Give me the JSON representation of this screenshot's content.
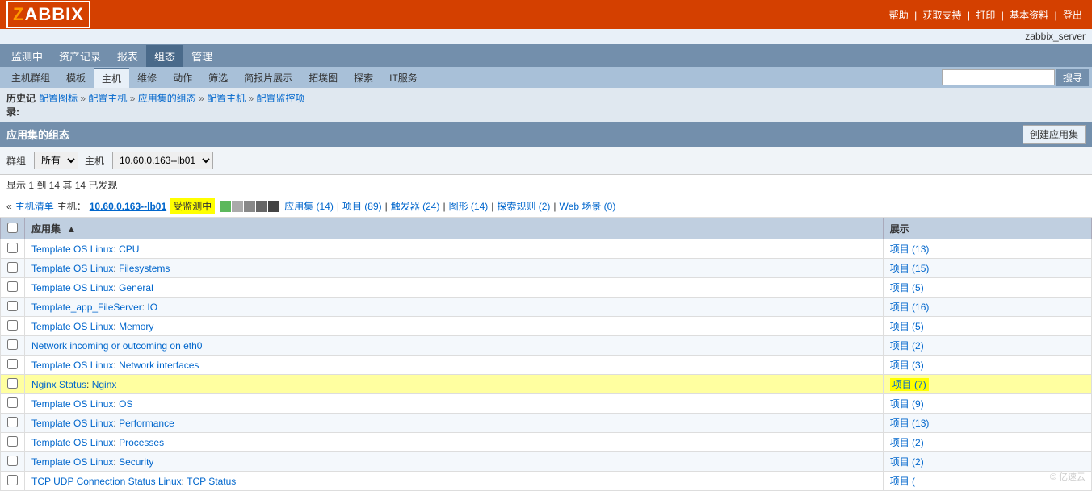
{
  "app": {
    "logo": "ZABBIX",
    "server_name": "zabbix_server"
  },
  "top_links": [
    "帮助",
    "获取支持",
    "打印",
    "基本资料",
    "登出"
  ],
  "main_nav": [
    {
      "label": "监测中",
      "active": false
    },
    {
      "label": "资产记录",
      "active": false
    },
    {
      "label": "报表",
      "active": false
    },
    {
      "label": "组态",
      "active": true
    },
    {
      "label": "管理",
      "active": false
    }
  ],
  "sub_nav": [
    {
      "label": "主机群组",
      "active": false
    },
    {
      "label": "模板",
      "active": false
    },
    {
      "label": "主机",
      "active": true
    },
    {
      "label": "维修",
      "active": false
    },
    {
      "label": "动作",
      "active": false
    },
    {
      "label": "筛选",
      "active": false
    },
    {
      "label": "简报片展示",
      "active": false
    },
    {
      "label": "拓墣图",
      "active": false
    },
    {
      "label": "探索",
      "active": false
    },
    {
      "label": "IT服务",
      "active": false
    }
  ],
  "search": {
    "placeholder": "",
    "button_label": "搜寻"
  },
  "breadcrumb": {
    "history_label": "历史记\n录:",
    "items": [
      {
        "label": "配置图标",
        "href": "#"
      },
      {
        "label": "配置主机",
        "href": "#"
      },
      {
        "label": "应用集的组态",
        "href": "#"
      },
      {
        "label": "配置主机",
        "href": "#"
      },
      {
        "label": "配置监控项",
        "href": "#"
      }
    ]
  },
  "page_title": "应用集的组态",
  "create_button_label": "创建应用集",
  "filter": {
    "group_label": "群组",
    "group_value": "所有",
    "host_label": "主机",
    "host_value": "10.60.0.163--lb01",
    "group_options": [
      "所有"
    ],
    "host_options": [
      "10.60.0.163--lb01"
    ]
  },
  "count_info": "显示 1 到 14 其 14 已发现",
  "context_bar": {
    "prefix": "«",
    "list_label": "主机清单",
    "host_label": "主机：",
    "host_link": "10.60.0.163--lb01",
    "monitoring_label": "受监测中",
    "status_colors": [
      "#5cb85c",
      "#d9534f",
      "#f0ad4e",
      "#777",
      "#999"
    ],
    "links": [
      {
        "label": "应用集 (14)"
      },
      {
        "label": "项目 (89)"
      },
      {
        "label": "触发器 (24)"
      },
      {
        "label": "图形 (14)"
      },
      {
        "label": "探索规则 (2)"
      },
      {
        "label": "Web 场景 (0)"
      }
    ]
  },
  "table": {
    "columns": [
      {
        "label": "",
        "type": "checkbox"
      },
      {
        "label": "应用集",
        "sortable": true
      },
      {
        "label": "展示"
      }
    ],
    "rows": [
      {
        "id": 1,
        "name": "Template OS Linux",
        "name2": "CPU",
        "link1": "Template OS Linux",
        "link2": "CPU",
        "items": "项目 (13)",
        "highlighted": false
      },
      {
        "id": 2,
        "name": "Template OS Linux",
        "name2": "Filesystems",
        "link1": "Template OS Linux",
        "link2": "Filesystems",
        "items": "项目 (15)",
        "highlighted": false
      },
      {
        "id": 3,
        "name": "Template OS Linux",
        "name2": "General",
        "link1": "Template OS Linux",
        "link2": "General",
        "items": "项目 (5)",
        "highlighted": false
      },
      {
        "id": 4,
        "name": "Template_app_FileServer",
        "name2": "IO",
        "link1": "Template_app_FileServer",
        "link2": "IO",
        "items": "项目 (16)",
        "highlighted": false
      },
      {
        "id": 5,
        "name": "Template OS Linux",
        "name2": "Memory",
        "link1": "Template OS Linux",
        "link2": "Memory",
        "items": "项目 (5)",
        "highlighted": false
      },
      {
        "id": 6,
        "name": "Network incoming or outcoming on eth0",
        "name2": "Network incoming or outcoming on eth0",
        "link1": "Network incoming or outcoming on eth0",
        "link2": "",
        "items": "项目 (2)",
        "highlighted": false
      },
      {
        "id": 7,
        "name": "Template OS Linux",
        "name2": "Network interfaces",
        "link1": "Template OS Linux",
        "link2": "Network interfaces",
        "items": "项目 (3)",
        "highlighted": false
      },
      {
        "id": 8,
        "name": "Nginx Status",
        "name2": "Nginx",
        "link1": "Nginx Status",
        "link2": "Nginx",
        "items": "项目 (7)",
        "highlighted": true
      },
      {
        "id": 9,
        "name": "Template OS Linux",
        "name2": "OS",
        "link1": "Template OS Linux",
        "link2": "OS",
        "items": "项目 (9)",
        "highlighted": false
      },
      {
        "id": 10,
        "name": "Template OS Linux",
        "name2": "Performance",
        "link1": "Template OS Linux",
        "link2": "Performance",
        "items": "项目 (13)",
        "highlighted": false
      },
      {
        "id": 11,
        "name": "Template OS Linux",
        "name2": "Processes",
        "link1": "Template OS Linux",
        "link2": "Processes",
        "items": "项目 (2)",
        "highlighted": false
      },
      {
        "id": 12,
        "name": "Template OS Linux",
        "name2": "Security",
        "link1": "Template OS Linux",
        "link2": "Security",
        "items": "项目 (2)",
        "highlighted": false
      },
      {
        "id": 13,
        "name": "TCP UDP Connection Status Linux",
        "name2": "TCP Status",
        "link1": "TCP UDP Connection Status Linux",
        "link2": "TCP Status",
        "items": "项目 (",
        "highlighted": false
      }
    ]
  },
  "watermark": "© 亿速云"
}
